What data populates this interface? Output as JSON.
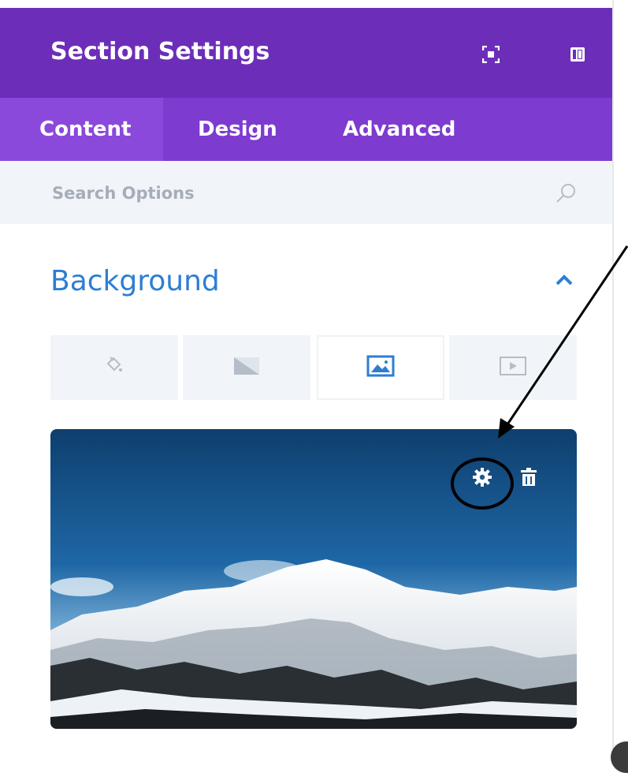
{
  "header": {
    "title": "Section Settings",
    "icons": [
      "expand-icon",
      "sidebar-layout-icon"
    ]
  },
  "tabs": [
    {
      "label": "Content",
      "active": true
    },
    {
      "label": "Design",
      "active": false
    },
    {
      "label": "Advanced",
      "active": false
    }
  ],
  "search": {
    "placeholder": "Search Options",
    "value": ""
  },
  "section": {
    "title": "Background",
    "expanded": true
  },
  "background_types": [
    {
      "icon": "paint-bucket-icon",
      "active": false
    },
    {
      "icon": "gradient-icon",
      "active": false
    },
    {
      "icon": "image-icon",
      "active": true
    },
    {
      "icon": "video-icon",
      "active": false
    }
  ],
  "image": {
    "icons": [
      "gear-icon",
      "trash-icon"
    ]
  },
  "colors": {
    "header": "#6c2eb9",
    "tabs": "#7e3bd0",
    "active_tab": "#8a49db",
    "accent": "#2c7ed3"
  }
}
